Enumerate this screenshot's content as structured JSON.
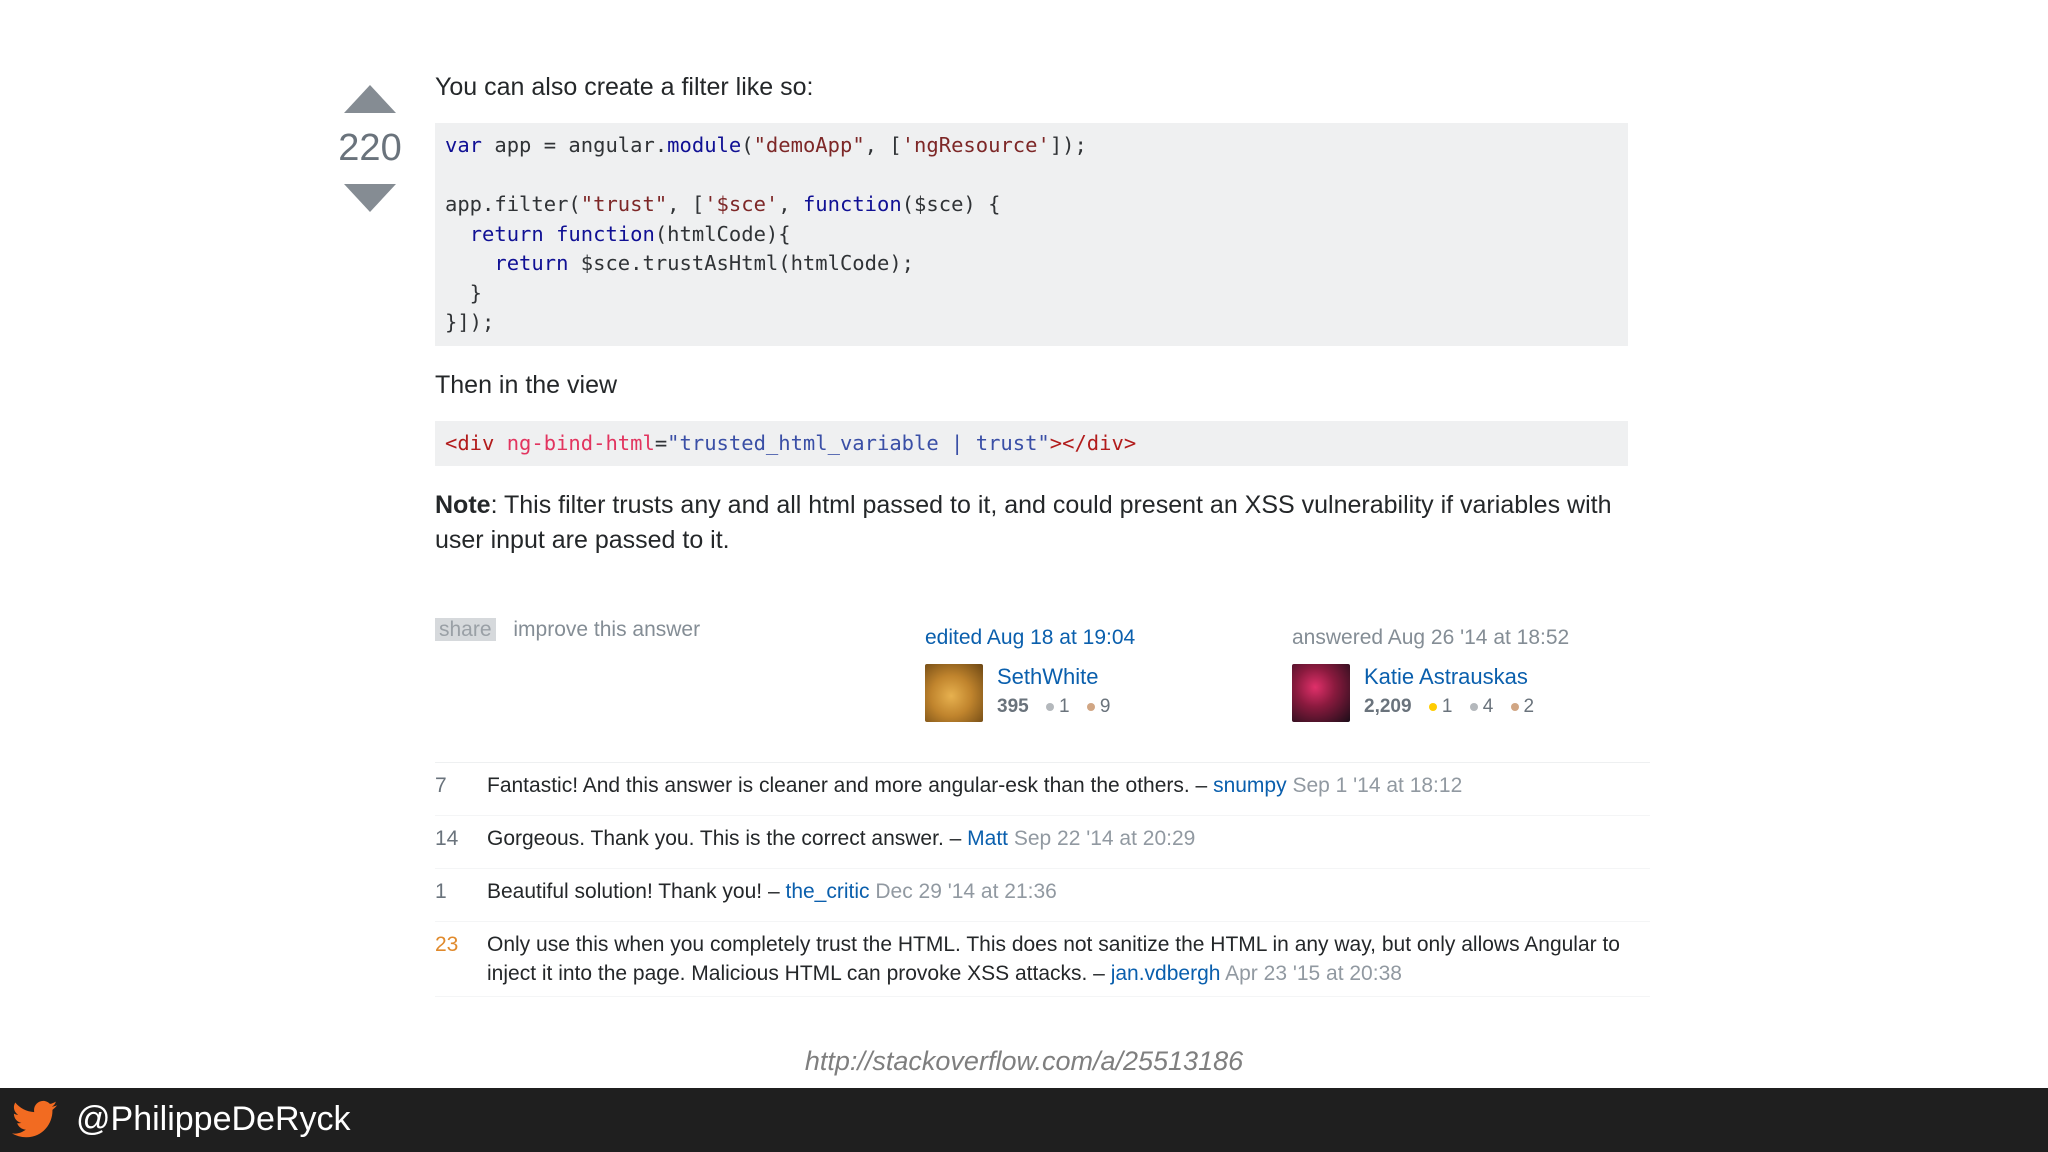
{
  "vote": {
    "count": "220"
  },
  "answer": {
    "intro": "You can also create a filter like so:",
    "code1": [
      [
        {
          "t": "var",
          "c": "kw"
        },
        {
          "t": " app = angular.",
          "c": "pl"
        },
        {
          "t": "module",
          "c": "kw"
        },
        {
          "t": "(",
          "c": "pl"
        },
        {
          "t": "\"demoApp\"",
          "c": "str"
        },
        {
          "t": ", [",
          "c": "pl"
        },
        {
          "t": "'ngResource'",
          "c": "str"
        },
        {
          "t": "]);",
          "c": "pl"
        }
      ],
      [],
      [
        {
          "t": "app.filter(",
          "c": "pl"
        },
        {
          "t": "\"trust\"",
          "c": "str"
        },
        {
          "t": ", [",
          "c": "pl"
        },
        {
          "t": "'$sce'",
          "c": "str"
        },
        {
          "t": ", ",
          "c": "pl"
        },
        {
          "t": "function",
          "c": "kw"
        },
        {
          "t": "($sce) {",
          "c": "pl"
        }
      ],
      [
        {
          "t": "  ",
          "c": "pl"
        },
        {
          "t": "return",
          "c": "kw"
        },
        {
          "t": " ",
          "c": "pl"
        },
        {
          "t": "function",
          "c": "kw"
        },
        {
          "t": "(htmlCode){",
          "c": "pl"
        }
      ],
      [
        {
          "t": "    ",
          "c": "pl"
        },
        {
          "t": "return",
          "c": "kw"
        },
        {
          "t": " $sce.trustAsHtml(htmlCode);",
          "c": "pl"
        }
      ],
      [
        {
          "t": "  }",
          "c": "pl"
        }
      ],
      [
        {
          "t": "}]);",
          "c": "pl"
        }
      ]
    ],
    "view_text": "Then in the view",
    "code2": [
      [
        {
          "t": "<div ",
          "c": "tag"
        },
        {
          "t": "ng-bind-html",
          "c": "attr"
        },
        {
          "t": "=",
          "c": "pl"
        },
        {
          "t": "\"trusted_html_variable | trust\"",
          "c": "val"
        },
        {
          "t": "></div>",
          "c": "tag"
        }
      ]
    ],
    "note_label": "Note",
    "note_text": ": This filter trusts any and all html passed to it, and could present an XSS vulnerability if variables with user input are passed to it."
  },
  "post_menu": {
    "share": "share",
    "improve": "improve this answer"
  },
  "edited": {
    "action": "edited Aug 18 at 19:04",
    "user": "SethWhite",
    "rep": "395",
    "silver": "1",
    "bronze": "9"
  },
  "answered": {
    "action": "answered Aug 26 '14 at 18:52",
    "user": "Katie Astrauskas",
    "rep": "2,209",
    "gold": "1",
    "silver": "4",
    "bronze": "2"
  },
  "comments": [
    {
      "score": "7",
      "text": "Fantastic! And this answer is cleaner and more angular-esk than the others. – ",
      "user": "snumpy",
      "date": "Sep 1 '14 at 18:12"
    },
    {
      "score": "14",
      "text": "Gorgeous. Thank you. This is the correct answer. – ",
      "user": "Matt",
      "date": "Sep 22 '14 at 20:29"
    },
    {
      "score": "1",
      "text": "Beautiful solution! Thank you! – ",
      "user": "the_critic",
      "date": "Dec 29 '14 at 21:36"
    },
    {
      "score": "23",
      "text": "Only use this when you completely trust the HTML. This does not sanitize the HTML in any way, but only allows Angular to inject it into the page. Malicious HTML can provoke XSS attacks. – ",
      "user": "jan.vdbergh",
      "date": "Apr 23 '15 at 20:38"
    }
  ],
  "source_url": "http://stackoverflow.com/a/25513186",
  "footer": {
    "handle": "@PhilippeDeRyck",
    "icon": "twitter-bird-icon",
    "accent": "#f26b21"
  }
}
